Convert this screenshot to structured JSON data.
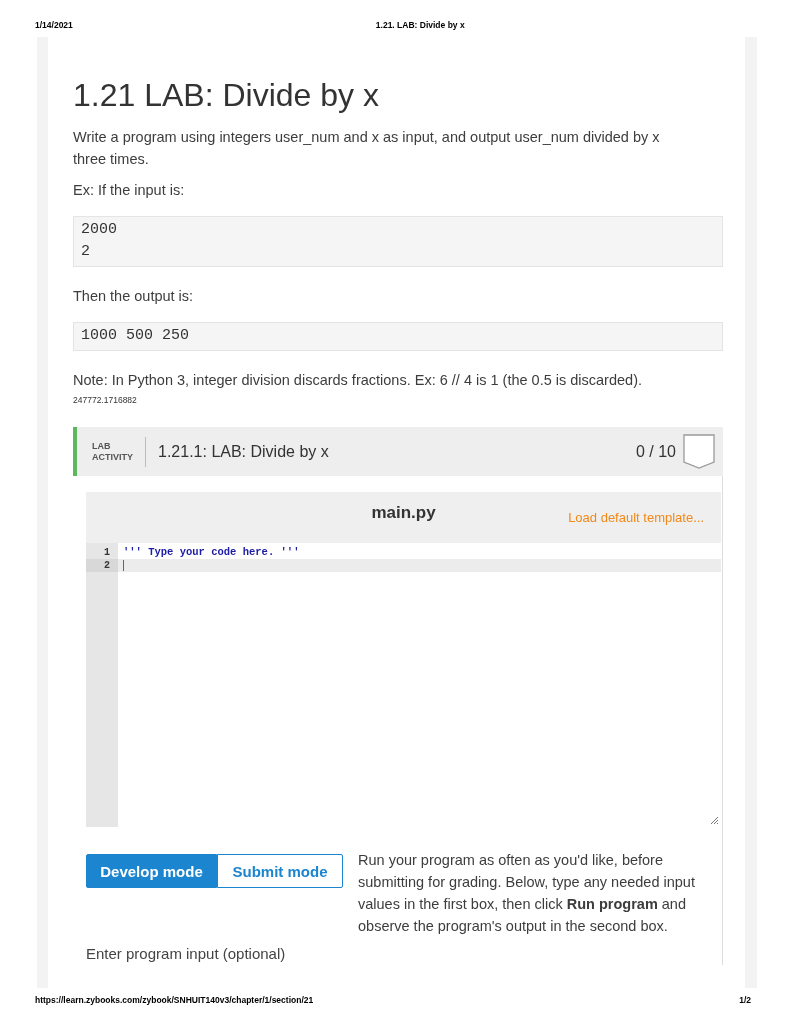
{
  "print_header": {
    "date": "1/14/2021",
    "title": "1.21. LAB: Divide by x"
  },
  "section": {
    "title": "1.21 LAB: Divide by x",
    "blocks": [
      {
        "kind": "paragraph",
        "text": "Write a program using integers user_num and x as input, and output user_num divided by x three times."
      },
      {
        "kind": "paragraph",
        "text": "Ex: If the input is:"
      },
      {
        "kind": "code",
        "lines": [
          "2000",
          "2"
        ]
      },
      {
        "kind": "paragraph",
        "text": "Then the output is:"
      },
      {
        "kind": "code",
        "lines": [
          "1000 500 250"
        ]
      },
      {
        "kind": "paragraph",
        "text": "Note: In Python 3, integer division discards fractions. Ex: 6 // 4 is 1 (the 0.5 is discarded)."
      },
      {
        "kind": "id",
        "text": "247772.1716882"
      }
    ]
  },
  "lab": {
    "label": "LAB ACTIVITY",
    "title": "1.21.1: LAB: Divide by x",
    "score": "0 / 10",
    "editor": {
      "filename": "main.py",
      "load_link": "Load default template...",
      "lines": [
        {
          "number": "1",
          "code": "''' Type your code here. '''",
          "active": false
        },
        {
          "number": "2",
          "active": true
        }
      ]
    },
    "modes": [
      {
        "label": "Develop mode",
        "selected": true
      },
      {
        "label": "Submit mode",
        "selected": false
      }
    ],
    "help": "Run your program as often as you'd like, before submitting for grading. Below, type any needed input values in the first box, then click **Run program** and observe the program's output in the second box.",
    "input_label": "Enter program input (optional)"
  },
  "print_footer": {
    "url": "https://learn.zybooks.com/zybook/SNHUIT140v3/chapter/1/section/21",
    "page": "1/2"
  }
}
